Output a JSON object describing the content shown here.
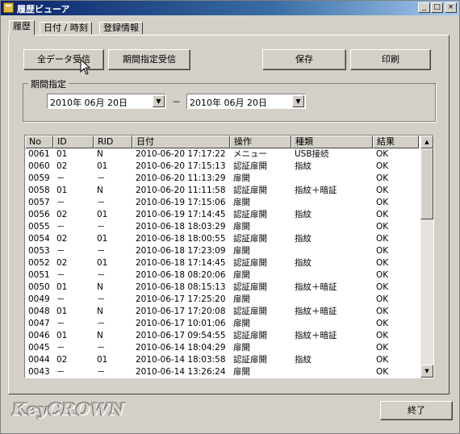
{
  "window": {
    "title": "履歴ビューア",
    "min_icon": "minimize-icon",
    "max_icon": "maximize-icon",
    "close_icon": "close-icon"
  },
  "tabs": [
    {
      "label": "履歴"
    },
    {
      "label": "日付 / 時刻"
    },
    {
      "label": "登録情報"
    }
  ],
  "toolbar": {
    "receive_all": "全データ受信",
    "receive_period": "期間指定受信",
    "save": "保存",
    "print": "印刷"
  },
  "period": {
    "label": "期間指定",
    "from": "2010年 06月 20日",
    "separator": "－",
    "to": "2010年 06月 20日"
  },
  "table": {
    "columns": [
      "No",
      "ID",
      "RID",
      "日付",
      "操作",
      "種類",
      "結果"
    ],
    "rows": [
      [
        "0061",
        "01",
        "N",
        "2010-06-20 17:17:22",
        "メニュー",
        "USB接続",
        "OK"
      ],
      [
        "0060",
        "02",
        "01",
        "2010-06-20 17:15:13",
        "認証扉開",
        "指紋",
        "OK"
      ],
      [
        "0059",
        "－",
        "－",
        "2010-06-20 11:13:29",
        "扉開",
        "",
        "OK"
      ],
      [
        "0058",
        "01",
        "N",
        "2010-06-20 11:11:58",
        "認証扉開",
        "指紋＋暗証",
        "OK"
      ],
      [
        "0057",
        "－",
        "－",
        "2010-06-19 17:15:06",
        "扉開",
        "",
        "OK"
      ],
      [
        "0056",
        "02",
        "01",
        "2010-06-19 17:14:45",
        "認証扉開",
        "指紋",
        "OK"
      ],
      [
        "0055",
        "－",
        "－",
        "2010-06-18 18:03:29",
        "扉開",
        "",
        "OK"
      ],
      [
        "0054",
        "02",
        "01",
        "2010-06-18 18:00:55",
        "認証扉開",
        "指紋",
        "OK"
      ],
      [
        "0053",
        "－",
        "－",
        "2010-06-18 17:23:09",
        "扉開",
        "",
        "OK"
      ],
      [
        "0052",
        "02",
        "01",
        "2010-06-18 17:14:45",
        "認証扉開",
        "指紋",
        "OK"
      ],
      [
        "0051",
        "－",
        "－",
        "2010-06-18 08:20:06",
        "扉開",
        "",
        "OK"
      ],
      [
        "0050",
        "01",
        "N",
        "2010-06-18 08:15:13",
        "認証扉開",
        "指紋＋暗証",
        "OK"
      ],
      [
        "0049",
        "－",
        "－",
        "2010-06-17 17:25:20",
        "扉開",
        "",
        "OK"
      ],
      [
        "0048",
        "01",
        "N",
        "2010-06-17 17:20:08",
        "認証扉開",
        "指紋＋暗証",
        "OK"
      ],
      [
        "0047",
        "－",
        "－",
        "2010-06-17 10:01:06",
        "扉開",
        "",
        "OK"
      ],
      [
        "0046",
        "01",
        "N",
        "2010-06-17 09:54:55",
        "認証扉開",
        "指紋＋暗証",
        "OK"
      ],
      [
        "0045",
        "－",
        "－",
        "2010-06-14 18:04:29",
        "扉開",
        "",
        "OK"
      ],
      [
        "0044",
        "02",
        "01",
        "2010-06-14 18:03:58",
        "認証扉開",
        "指紋",
        "OK"
      ],
      [
        "0043",
        "－",
        "－",
        "2010-06-14 13:26:24",
        "扉開",
        "",
        "OK"
      ]
    ]
  },
  "footer": {
    "logo": "KeyCROWN",
    "exit": "終了"
  }
}
